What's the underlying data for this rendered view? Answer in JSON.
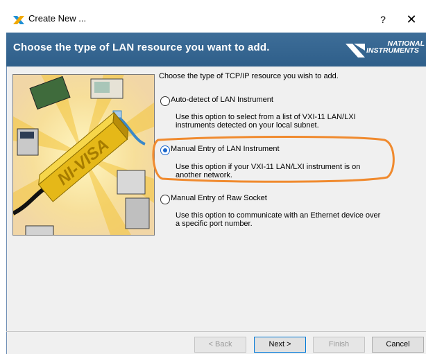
{
  "window": {
    "title": "Create New ...",
    "help_label": "?",
    "close_label": "✕"
  },
  "header": {
    "title": "Choose the type of LAN resource you want to add.",
    "logo_line1": "NATIONAL",
    "logo_line2": "INSTRUMENTS"
  },
  "illustration": {
    "brand_text": "NI-VISA"
  },
  "content": {
    "intro": "Choose the type of TCP/IP resource you wish to add.",
    "options": [
      {
        "label": "Auto-detect of LAN Instrument",
        "description": "Use this option to select from a list of VXI-11 LAN/LXI instruments detected on your local subnet.",
        "selected": false
      },
      {
        "label": "Manual Entry of LAN Instrument",
        "description": "Use this option if your VXI-11 LAN/LXI instrument is on another network.",
        "selected": true
      },
      {
        "label": "Manual Entry of Raw Socket",
        "description": "Use this option to communicate with an Ethernet device over a specific port number.",
        "selected": false
      }
    ]
  },
  "footer": {
    "back_label": "< Back",
    "next_label": "Next >",
    "finish_label": "Finish",
    "cancel_label": "Cancel"
  },
  "colors": {
    "header_bg": "#336592",
    "highlight": "#f08a2e",
    "radio_accent": "#1a66cc"
  }
}
